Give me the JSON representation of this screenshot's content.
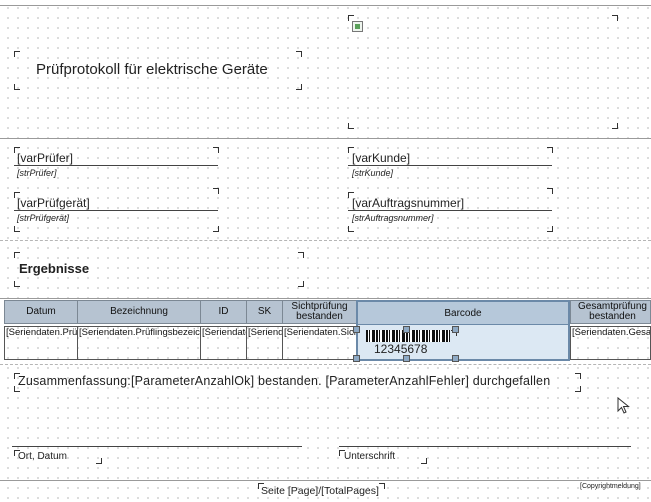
{
  "header": {
    "title": "Prüfprotokoll für elektrische Geräte"
  },
  "info_fields": {
    "pruefer": {
      "value": "[varPrüfer]",
      "label": "[strPrüfer]"
    },
    "pruefgeraet": {
      "value": "[varPrüfgerät]",
      "label": "[strPrüfgerät]"
    },
    "kunde": {
      "value": "[varKunde]",
      "label": "[strKunde]"
    },
    "auftragsnummer": {
      "value": "[varAuftragsnummer]",
      "label": "[strAuftragsnummer]"
    }
  },
  "results": {
    "heading": "Ergebnisse"
  },
  "table": {
    "headers": [
      "Datum",
      "Bezeichnung",
      "ID",
      "SK",
      "Sichtprüfung bestanden",
      "Barcode",
      "Gesamtprüfung bestanden"
    ],
    "row": [
      "[Seriendaten.Prüfdatum]",
      "[Seriendaten.Prüflingsbezeichnung]",
      "[Seriendaten.ID]",
      "[Seriendaten.SK]",
      "[Seriendaten.SichtprüfungOK]",
      "",
      "[Seriendaten.GesamtOK]"
    ],
    "barcode_number": "12345678"
  },
  "summary": {
    "text": "Zusammenfassung:[ParameterAnzahlOk] bestanden. [ParameterAnzahlFehler] durchgefallen"
  },
  "signature": {
    "ort_datum": "Ort, Datum",
    "unterschrift": "Unterschrift"
  },
  "footer": {
    "page": "Seite [Page]/[TotalPages]",
    "copyright": "[Copyrightmeldung]"
  },
  "icons": {
    "image_placeholder": "image-icon",
    "cursor": "mouse-pointer-icon"
  },
  "colors": {
    "header_fill": "#b6c3d1",
    "selection_fill": "#dce8f3",
    "selection_border": "#6b89a8"
  }
}
